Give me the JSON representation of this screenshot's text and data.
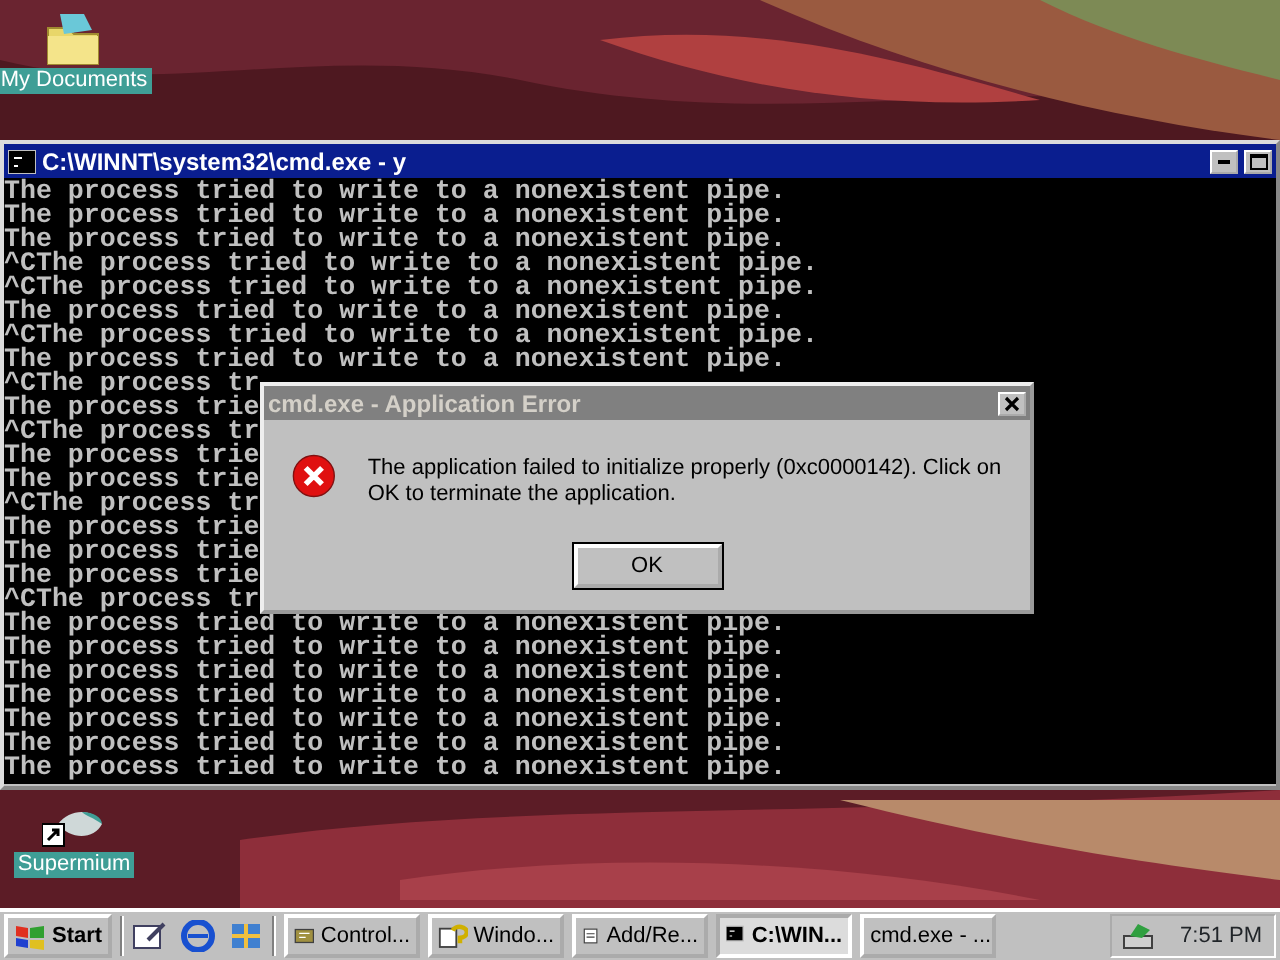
{
  "desktop_icons": [
    {
      "label": "My Documents",
      "kind": "folder"
    },
    {
      "label": "Supermium",
      "kind": "shortcut"
    }
  ],
  "console": {
    "title": "C:\\WINNT\\system32\\cmd.exe - y",
    "lines": [
      "The process tried to write to a nonexistent pipe.",
      "The process tried to write to a nonexistent pipe.",
      "The process tried to write to a nonexistent pipe.",
      "^CThe process tried to write to a nonexistent pipe.",
      "^CThe process tried to write to a nonexistent pipe.",
      "The process tried to write to a nonexistent pipe.",
      "^CThe process tried to write to a nonexistent pipe.",
      "The process tried to write to a nonexistent pipe.",
      "^CThe process tr",
      "The process trie",
      "^CThe process tr",
      "The process trie",
      "The process trie",
      "^CThe process tr",
      "The process trie",
      "The process trie",
      "The process trie",
      "^CThe process tr",
      "The process tried to write to a nonexistent pipe.",
      "The process tried to write to a nonexistent pipe.",
      "The process tried to write to a nonexistent pipe.",
      "The process tried to write to a nonexistent pipe.",
      "The process tried to write to a nonexistent pipe.",
      "The process tried to write to a nonexistent pipe.",
      "The process tried to write to a nonexistent pipe."
    ]
  },
  "dialog": {
    "title": "cmd.exe - Application Error",
    "message": "The application failed to initialize properly (0xc0000142). Click on OK to terminate the application.",
    "button": "OK"
  },
  "taskbar": {
    "start": "Start",
    "tasks": [
      {
        "label": "Control...",
        "kind": "control",
        "selected": false
      },
      {
        "label": "Windo...",
        "kind": "help",
        "selected": false
      },
      {
        "label": "Add/Re...",
        "kind": "install",
        "selected": false
      },
      {
        "label": "C:\\WIN...",
        "kind": "console",
        "selected": true
      },
      {
        "label": "cmd.exe - ...",
        "kind": "none",
        "selected": false
      }
    ],
    "clock": "7:51 PM"
  }
}
